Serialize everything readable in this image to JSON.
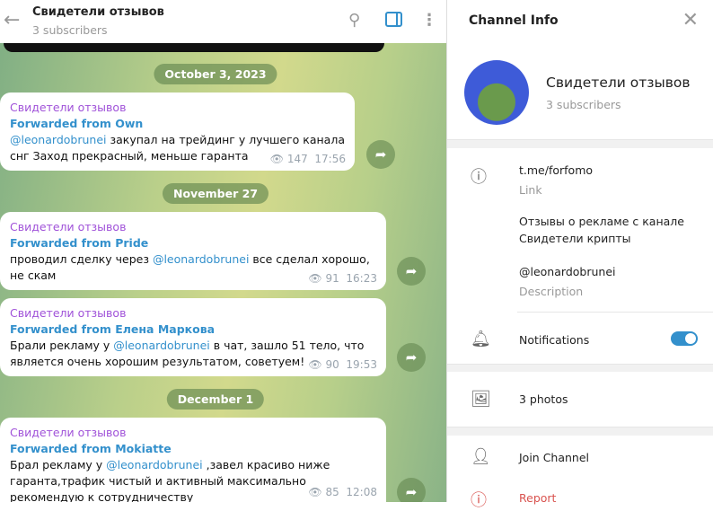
{
  "header": {
    "title": "Свидетели отзывов",
    "subtitle": "3 subscribers"
  },
  "dates": [
    "October 3, 2023",
    "November 27",
    "December 1"
  ],
  "messages": [
    {
      "author": "Свидетели отзывов",
      "forwarded": "Forwarded from Own",
      "mention": "@leonardobrunei",
      "text": " закупал на трейдинг у лучшего канала снг Заход прекрасный, меньше гаранта",
      "pre": "",
      "views": "147",
      "time": "17:56"
    },
    {
      "author": "Свидетели отзывов",
      "forwarded": "Forwarded from Pride",
      "pre": "проводил сделку через ",
      "mention": "@leonardobrunei",
      "text": " все сделал хорошо, не скам",
      "views": "91",
      "time": "16:23"
    },
    {
      "author": "Свидетели отзывов",
      "forwarded": "Forwarded from Елена Маркова",
      "pre": "Брали рекламу у ",
      "mention": "@leonardobrunei",
      "text": " в чат, зашло 51 тело, что является очень хорошим результатом, советуем!",
      "views": "90",
      "time": "19:53"
    },
    {
      "author": "Свидетели отзывов",
      "forwarded": "Forwarded from Mokiatte",
      "pre": "Брал рекламу у ",
      "mention": "@leonardobrunei",
      "text": " ,завел красиво ниже гаранта,трафик чистый и активный максимально рекомендую к сотрудничеству",
      "views": "85",
      "time": "12:08"
    }
  ],
  "info": {
    "title": "Channel Info",
    "name": "Свидетели отзывов",
    "subscribers": "3 subscribers",
    "link": "t.me/forfomo",
    "link_label": "Link",
    "description_line1": "Отзывы о рекламе с канале",
    "description_line2": "Свидетели крипты",
    "description_mention": "@leonardobrunei",
    "description_label": "Description",
    "notifications": "Notifications",
    "notifications_on": true,
    "photos": "3 photos",
    "join": "Join Channel",
    "report": "Report"
  }
}
